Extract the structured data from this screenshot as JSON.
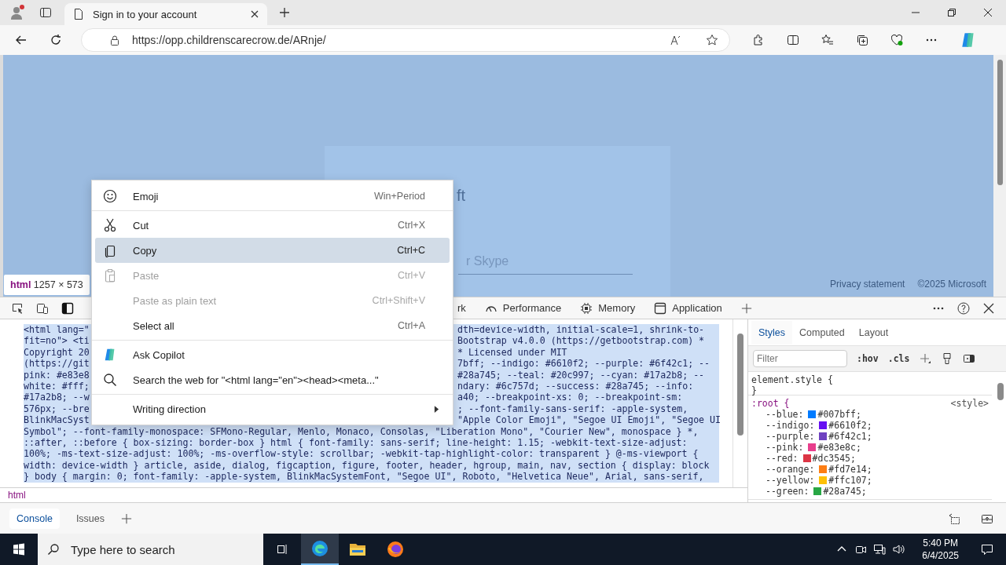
{
  "browser": {
    "tabs": [
      {
        "title": "Sign in to your account",
        "selected": true
      }
    ],
    "url": "https://opp.childrenscarecrow.de/ARnje/"
  },
  "page": {
    "logo_text": "ft",
    "field_placeholder": "r Skype",
    "footer_links": [
      "Privacy statement",
      "©2025 Microsoft"
    ],
    "element_tooltip": {
      "tag": "html",
      "size": "1257 × 573"
    }
  },
  "devtools": {
    "tabs": [
      {
        "label": "rk",
        "selected": false
      },
      {
        "label": "Performance",
        "selected": false
      },
      {
        "label": "Memory",
        "selected": false
      },
      {
        "label": "Application",
        "selected": false
      }
    ],
    "code_lines": [
      {
        "left": "<html lang=\"",
        "right": "dth=device-width, initial-scale=1, shrink-to-"
      },
      {
        "left": "fit=no\"> <ti",
        "right": "Bootstrap v4.0.0 (https://getbootstrap.com) *"
      },
      {
        "left": "Copyright 20",
        "right": "* Licensed under MIT"
      },
      {
        "left": "(https://git",
        "right": "7bff; --indigo: #6610f2; --purple: #6f42c1; --"
      },
      {
        "left": "pink: #e83e8",
        "right": "#28a745; --teal: #20c997; --cyan: #17a2b8; --"
      },
      {
        "left": "white: #fff;",
        "right": "ndary: #6c757d; --success: #28a745; --info:"
      },
      {
        "left": "#17a2b8; --w",
        "right": "a40; --breakpoint-xs: 0; --breakpoint-sm:"
      },
      {
        "left": "576px; --bre",
        "right": "; --font-family-sans-serif: -apple-system,"
      },
      {
        "left": "BlinkMacSyst",
        "right": "\"Apple Color Emoji\", \"Segoe UI Emoji\", \"Segoe UI"
      },
      {
        "left": "Symbol\"; --font-family-monospace: SFMono-Regular, Menlo, Monaco, Consolas, \"Liberation Mono\", \"Courier New\", monospace } *,"
      },
      {
        "left": "::after, ::before { box-sizing: border-box } html { font-family: sans-serif; line-height: 1.15; -webkit-text-size-adjust:"
      },
      {
        "left": "100%; -ms-text-size-adjust: 100%; -ms-overflow-style: scrollbar; -webkit-tap-highlight-color: transparent } @-ms-viewport {"
      },
      {
        "left": "width: device-width } article, aside, dialog, figcaption, figure, footer, header, hgroup, main, nav, section { display: block"
      },
      {
        "left": "} body { margin: 0; font-family: -apple-system, BlinkMacSystemFont, \"Segoe UI\", Roboto, \"Helvetica Neue\", Arial, sans-serif,"
      }
    ],
    "breadcrumb": "html",
    "styles_tabs": [
      {
        "label": "Styles",
        "selected": true
      },
      {
        "label": "Computed",
        "selected": false
      },
      {
        "label": "Layout",
        "selected": false
      }
    ],
    "filter_placeholder": "Filter",
    "style_toggles": [
      ":hov",
      ".cls"
    ],
    "element_style": [
      "element.style {",
      "}"
    ],
    "root_rule": {
      "selector": ":root {",
      "source": "<style>",
      "vars": [
        {
          "name": "--blue:",
          "value": "#007bff;",
          "color": "#007bff"
        },
        {
          "name": "--indigo:",
          "value": "#6610f2;",
          "color": "#6610f2"
        },
        {
          "name": "--purple:",
          "value": "#6f42c1;",
          "color": "#6f42c1"
        },
        {
          "name": "--pink:",
          "value": "#e83e8c;",
          "color": "#e83e8c"
        },
        {
          "name": "--red:",
          "value": "#dc3545;",
          "color": "#dc3545"
        },
        {
          "name": "--orange:",
          "value": "#fd7e14;",
          "color": "#fd7e14"
        },
        {
          "name": "--yellow:",
          "value": "#ffc107;",
          "color": "#ffc107"
        },
        {
          "name": "--green:",
          "value": "#28a745;",
          "color": "#28a745"
        }
      ]
    },
    "drawer_tabs": [
      {
        "label": "Console",
        "selected": true
      },
      {
        "label": "Issues",
        "selected": false
      }
    ]
  },
  "context_menu": {
    "items": [
      {
        "kind": "item",
        "label": "Emoji",
        "shortcut": "Win+Period",
        "disabled": false,
        "selected": false
      },
      {
        "kind": "separator"
      },
      {
        "kind": "item",
        "label": "Cut",
        "shortcut": "Ctrl+X",
        "disabled": false,
        "selected": false
      },
      {
        "kind": "item",
        "label": "Copy",
        "shortcut": "Ctrl+C",
        "disabled": false,
        "selected": true
      },
      {
        "kind": "item",
        "label": "Paste",
        "shortcut": "Ctrl+V",
        "disabled": true,
        "selected": false
      },
      {
        "kind": "item",
        "label": "Paste as plain text",
        "shortcut": "Ctrl+Shift+V",
        "disabled": true,
        "selected": false
      },
      {
        "kind": "item",
        "label": "Select all",
        "shortcut": "Ctrl+A",
        "disabled": false,
        "selected": false
      },
      {
        "kind": "separator"
      },
      {
        "kind": "item",
        "label": "Ask Copilot",
        "disabled": false,
        "selected": false
      },
      {
        "kind": "item",
        "label": "Search the web for \"<html lang=\"en\"><head><meta...\"",
        "disabled": false,
        "selected": false
      },
      {
        "kind": "separator"
      },
      {
        "kind": "submenu",
        "label": "Writing direction",
        "disabled": false,
        "selected": false
      }
    ]
  },
  "taskbar": {
    "search_placeholder": "Type here to search",
    "time": "5:40 PM",
    "date": "6/4/2025"
  }
}
